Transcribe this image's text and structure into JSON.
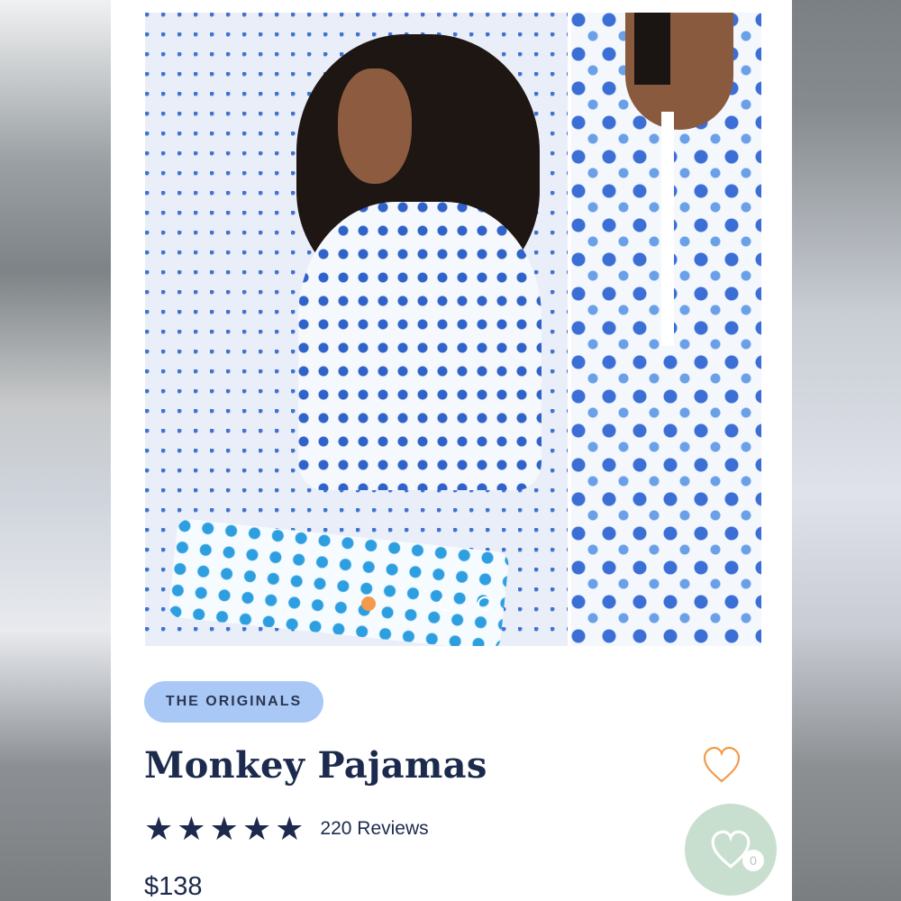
{
  "gallery": {
    "images": [
      {
        "alt": "model-in-monkey-pajamas-icon"
      },
      {
        "alt": "pajama-collar-closeup-icon"
      }
    ],
    "active_index": 0,
    "dot_count": 3
  },
  "product": {
    "collection": "THE ORIGINALS",
    "name": "Monkey Pajamas",
    "rating": 5,
    "reviews_label": "220 Reviews",
    "price": "$138"
  },
  "wishlist": {
    "count": "0"
  },
  "colors": {
    "navy": "#1c2a4d",
    "tag_bg": "#a9c8f5",
    "accent_orange": "#f39a4c",
    "fab_bg": "#c8dfd0"
  }
}
